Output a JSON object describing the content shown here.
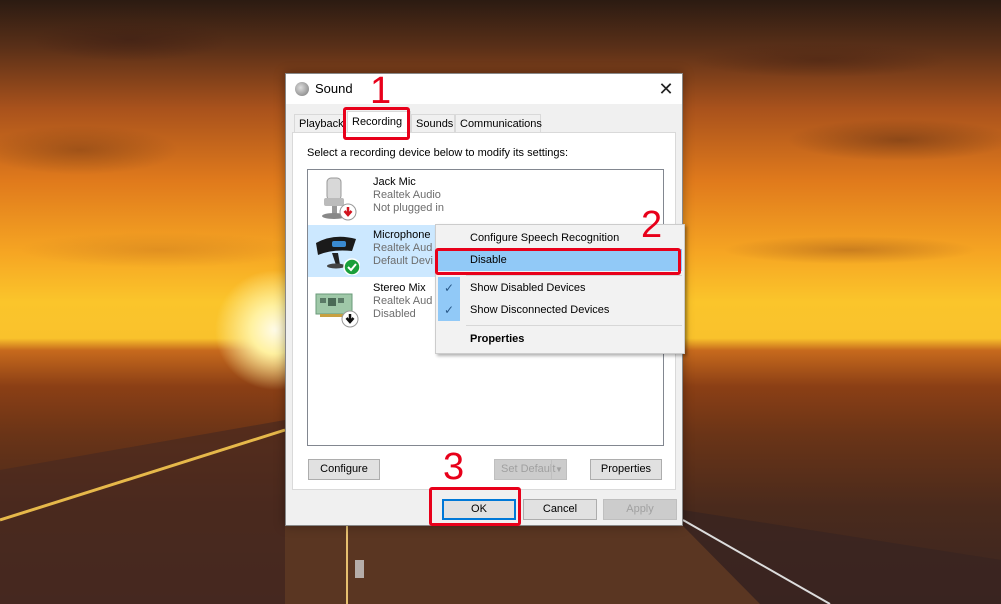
{
  "window": {
    "title": "Sound",
    "close_glyph": "✕"
  },
  "tabs": [
    {
      "label": "Playback",
      "active": false
    },
    {
      "label": "Recording",
      "active": true
    },
    {
      "label": "Sounds",
      "active": false
    },
    {
      "label": "Communications",
      "active": false
    }
  ],
  "instruction": "Select a recording device below to modify its settings:",
  "devices": [
    {
      "name": "Jack Mic",
      "driver": "Realtek Audio",
      "status": "Not plugged in",
      "icon": "microphone-icon",
      "badge": "red-down-arrow",
      "selected": false
    },
    {
      "name": "Microphone",
      "driver": "Realtek Aud",
      "status": "Default Devi",
      "icon": "webcam-microphone-icon",
      "badge": "green-check",
      "selected": true
    },
    {
      "name": "Stereo Mix",
      "driver": "Realtek Aud",
      "status": "Disabled",
      "icon": "sound-card-icon",
      "badge": "black-down-arrow",
      "selected": false
    }
  ],
  "buttons": {
    "configure": "Configure",
    "set_default": "Set Default",
    "properties": "Properties",
    "ok": "OK",
    "cancel": "Cancel",
    "apply": "Apply"
  },
  "context_menu": {
    "items": [
      {
        "label": "Configure Speech Recognition",
        "checked": false,
        "highlighted": false,
        "bold": false
      },
      {
        "label": "Disable",
        "checked": false,
        "highlighted": true,
        "bold": false
      },
      {
        "label": "Show Disabled Devices",
        "checked": true,
        "highlighted": false,
        "bold": false
      },
      {
        "label": "Show Disconnected Devices",
        "checked": true,
        "highlighted": false,
        "bold": false
      },
      {
        "label": "Properties",
        "checked": false,
        "highlighted": false,
        "bold": true
      }
    ],
    "check_glyph": "✓"
  },
  "annotations": {
    "step1": "1",
    "step2": "2",
    "step3": "3",
    "color": "#e8001a"
  }
}
